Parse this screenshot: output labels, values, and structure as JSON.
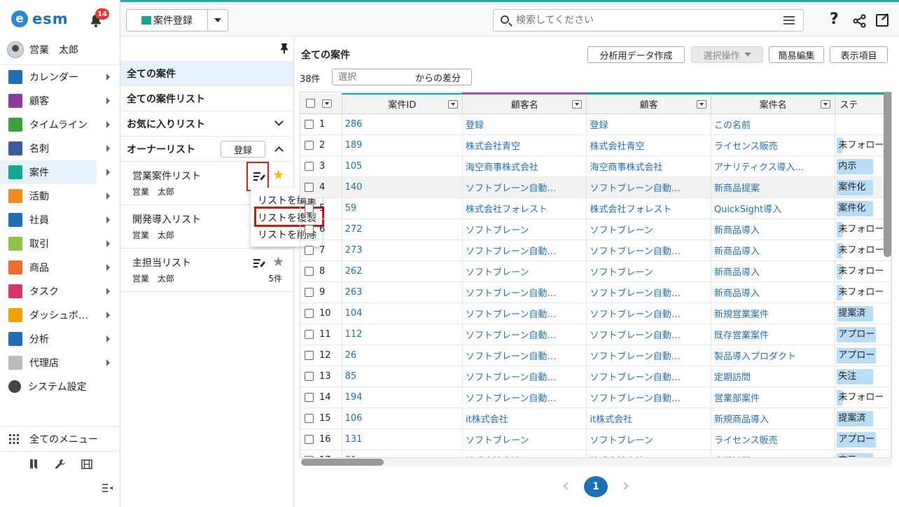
{
  "app": {
    "logo_text": "esm",
    "notification_count": "14"
  },
  "user": {
    "name": "営業　太郎"
  },
  "sidebar": {
    "items": [
      {
        "label": "カレンダー",
        "icon": "calendar-icon",
        "color": "#1f6fb5"
      },
      {
        "label": "顧客",
        "icon": "building-icon",
        "color": "#8b3d9e"
      },
      {
        "label": "タイムライン",
        "icon": "chat-icon",
        "color": "#3aa23a"
      },
      {
        "label": "名刺",
        "icon": "card-icon",
        "color": "#3d5a9e"
      },
      {
        "label": "案件",
        "icon": "folder-icon",
        "color": "#18a58f"
      },
      {
        "label": "活動",
        "icon": "clipboard-icon",
        "color": "#f08a1c"
      },
      {
        "label": "社員",
        "icon": "person-icon",
        "color": "#1f6fb5"
      },
      {
        "label": "取引",
        "icon": "ledger-icon",
        "color": "#8bc34a"
      },
      {
        "label": "商品",
        "icon": "box-icon",
        "color": "#ef6c2a"
      },
      {
        "label": "タスク",
        "icon": "task-icon",
        "color": "#d6336c"
      },
      {
        "label": "ダッシュボ…",
        "icon": "dashboard-icon",
        "color": "#f0a000"
      },
      {
        "label": "分析",
        "icon": "chart-icon",
        "color": "#1f6fb5"
      },
      {
        "label": "代理店",
        "icon": "document-icon",
        "color": "#bbbbbb"
      },
      {
        "label": "システム設定",
        "icon": "gear-icon",
        "color": "#444444"
      }
    ],
    "all_menu_label": "全てのメニュー"
  },
  "topbar": {
    "register_label": "案件登録",
    "search_placeholder": "検索してください",
    "help_glyph": "?"
  },
  "listpanel": {
    "all_label": "全ての案件",
    "all_list_label": "全ての案件リスト",
    "favorites_label": "お気に入りリスト",
    "owner_label": "オーナーリスト",
    "owner_register_label": "登録",
    "lists": [
      {
        "title": "営業案件リスト",
        "owner": "営業　太郎",
        "count": "",
        "starred": true
      },
      {
        "title": "開発導入リスト",
        "owner": "営業　太郎",
        "count": "",
        "starred": false
      },
      {
        "title": "主担当リスト",
        "owner": "営業　太郎",
        "count": "5件",
        "starred": false
      }
    ],
    "context_menu": [
      "リストを編集",
      "リストを複製",
      "リストを削除"
    ]
  },
  "main": {
    "title": "全ての案件",
    "buttons": {
      "analysis": "分析用データ作成",
      "select_ops": "選択操作",
      "quick_edit": "簡易編集",
      "columns": "表示項目"
    },
    "count": "38件",
    "diff_placeholder": "選択",
    "diff_suffix": "からの差分",
    "columns": [
      "案件ID",
      "顧客名",
      "顧客",
      "案件名",
      "ステ"
    ],
    "accent": {
      "customer_name": "#9b59b6",
      "customer": "#1aa3a0"
    },
    "rows": [
      {
        "n": "1",
        "id": "286",
        "cname": "登録",
        "cust": "登録",
        "deal": "この名前",
        "status": ""
      },
      {
        "n": "2",
        "id": "189",
        "cname": "株式会社青空",
        "cust": "株式会社青空",
        "deal": "ライセンス販売",
        "status": "未フォロー"
      },
      {
        "n": "3",
        "id": "105",
        "cname": "海空商事株式会社",
        "cust": "海空商事株式会社",
        "deal": "アナリティクス導入…",
        "status": "内示"
      },
      {
        "n": "4",
        "id": "140",
        "cname": "ソフトブレーン自動…",
        "cust": "ソフトブレーン自動…",
        "deal": "新商品提案",
        "status": "案件化"
      },
      {
        "n": "5",
        "id": "59",
        "cname": "株式会社フォレスト",
        "cust": "株式会社フォレスト",
        "deal": "QuickSight導入",
        "status": "案件化"
      },
      {
        "n": "6",
        "id": "272",
        "cname": "ソフトブレーン",
        "cust": "ソフトブレーン",
        "deal": "新商品導入",
        "status": "未フォロー"
      },
      {
        "n": "7",
        "id": "273",
        "cname": "ソフトブレーン自動…",
        "cust": "ソフトブレーン自動…",
        "deal": "新商品導入",
        "status": "未フォロー"
      },
      {
        "n": "8",
        "id": "262",
        "cname": "ソフトブレーン",
        "cust": "ソフトブレーン",
        "deal": "新商品導入",
        "status": "未フォロー"
      },
      {
        "n": "9",
        "id": "263",
        "cname": "ソフトブレーン自動…",
        "cust": "ソフトブレーン自動…",
        "deal": "新商品導入",
        "status": "未フォロー"
      },
      {
        "n": "10",
        "id": "104",
        "cname": "ソフトブレーン自動…",
        "cust": "ソフトブレーン自動…",
        "deal": "新規営業案件",
        "status": "提案済"
      },
      {
        "n": "11",
        "id": "112",
        "cname": "ソフトブレーン自動…",
        "cust": "ソフトブレーン自動…",
        "deal": "既存営業案件",
        "status": "アプロー"
      },
      {
        "n": "12",
        "id": "26",
        "cname": "ソフトブレーン自動…",
        "cust": "ソフトブレーン自動…",
        "deal": "製品導入プロダクト",
        "status": "アプロー"
      },
      {
        "n": "13",
        "id": "85",
        "cname": "ソフトブレーン自動…",
        "cust": "ソフトブレーン自動…",
        "deal": "定期訪問",
        "status": "失注"
      },
      {
        "n": "14",
        "id": "194",
        "cname": "ソフトブレーン自動…",
        "cust": "ソフトブレーン自動…",
        "deal": "営業部案件",
        "status": "未フォロー"
      },
      {
        "n": "15",
        "id": "106",
        "cname": "it株式会社",
        "cust": "it株式会社",
        "deal": "新規商品導入",
        "status": "提案済"
      },
      {
        "n": "16",
        "id": "131",
        "cname": "ソフトブレーン",
        "cust": "ソフトブレーン",
        "deal": "ライセンス販売",
        "status": "アプロー"
      },
      {
        "n": "17",
        "id": "31",
        "cname": "株式会社大地",
        "cust": "株式会社大地",
        "deal": "定期訪問",
        "status": "内示"
      }
    ]
  },
  "pager": {
    "current": "1"
  }
}
